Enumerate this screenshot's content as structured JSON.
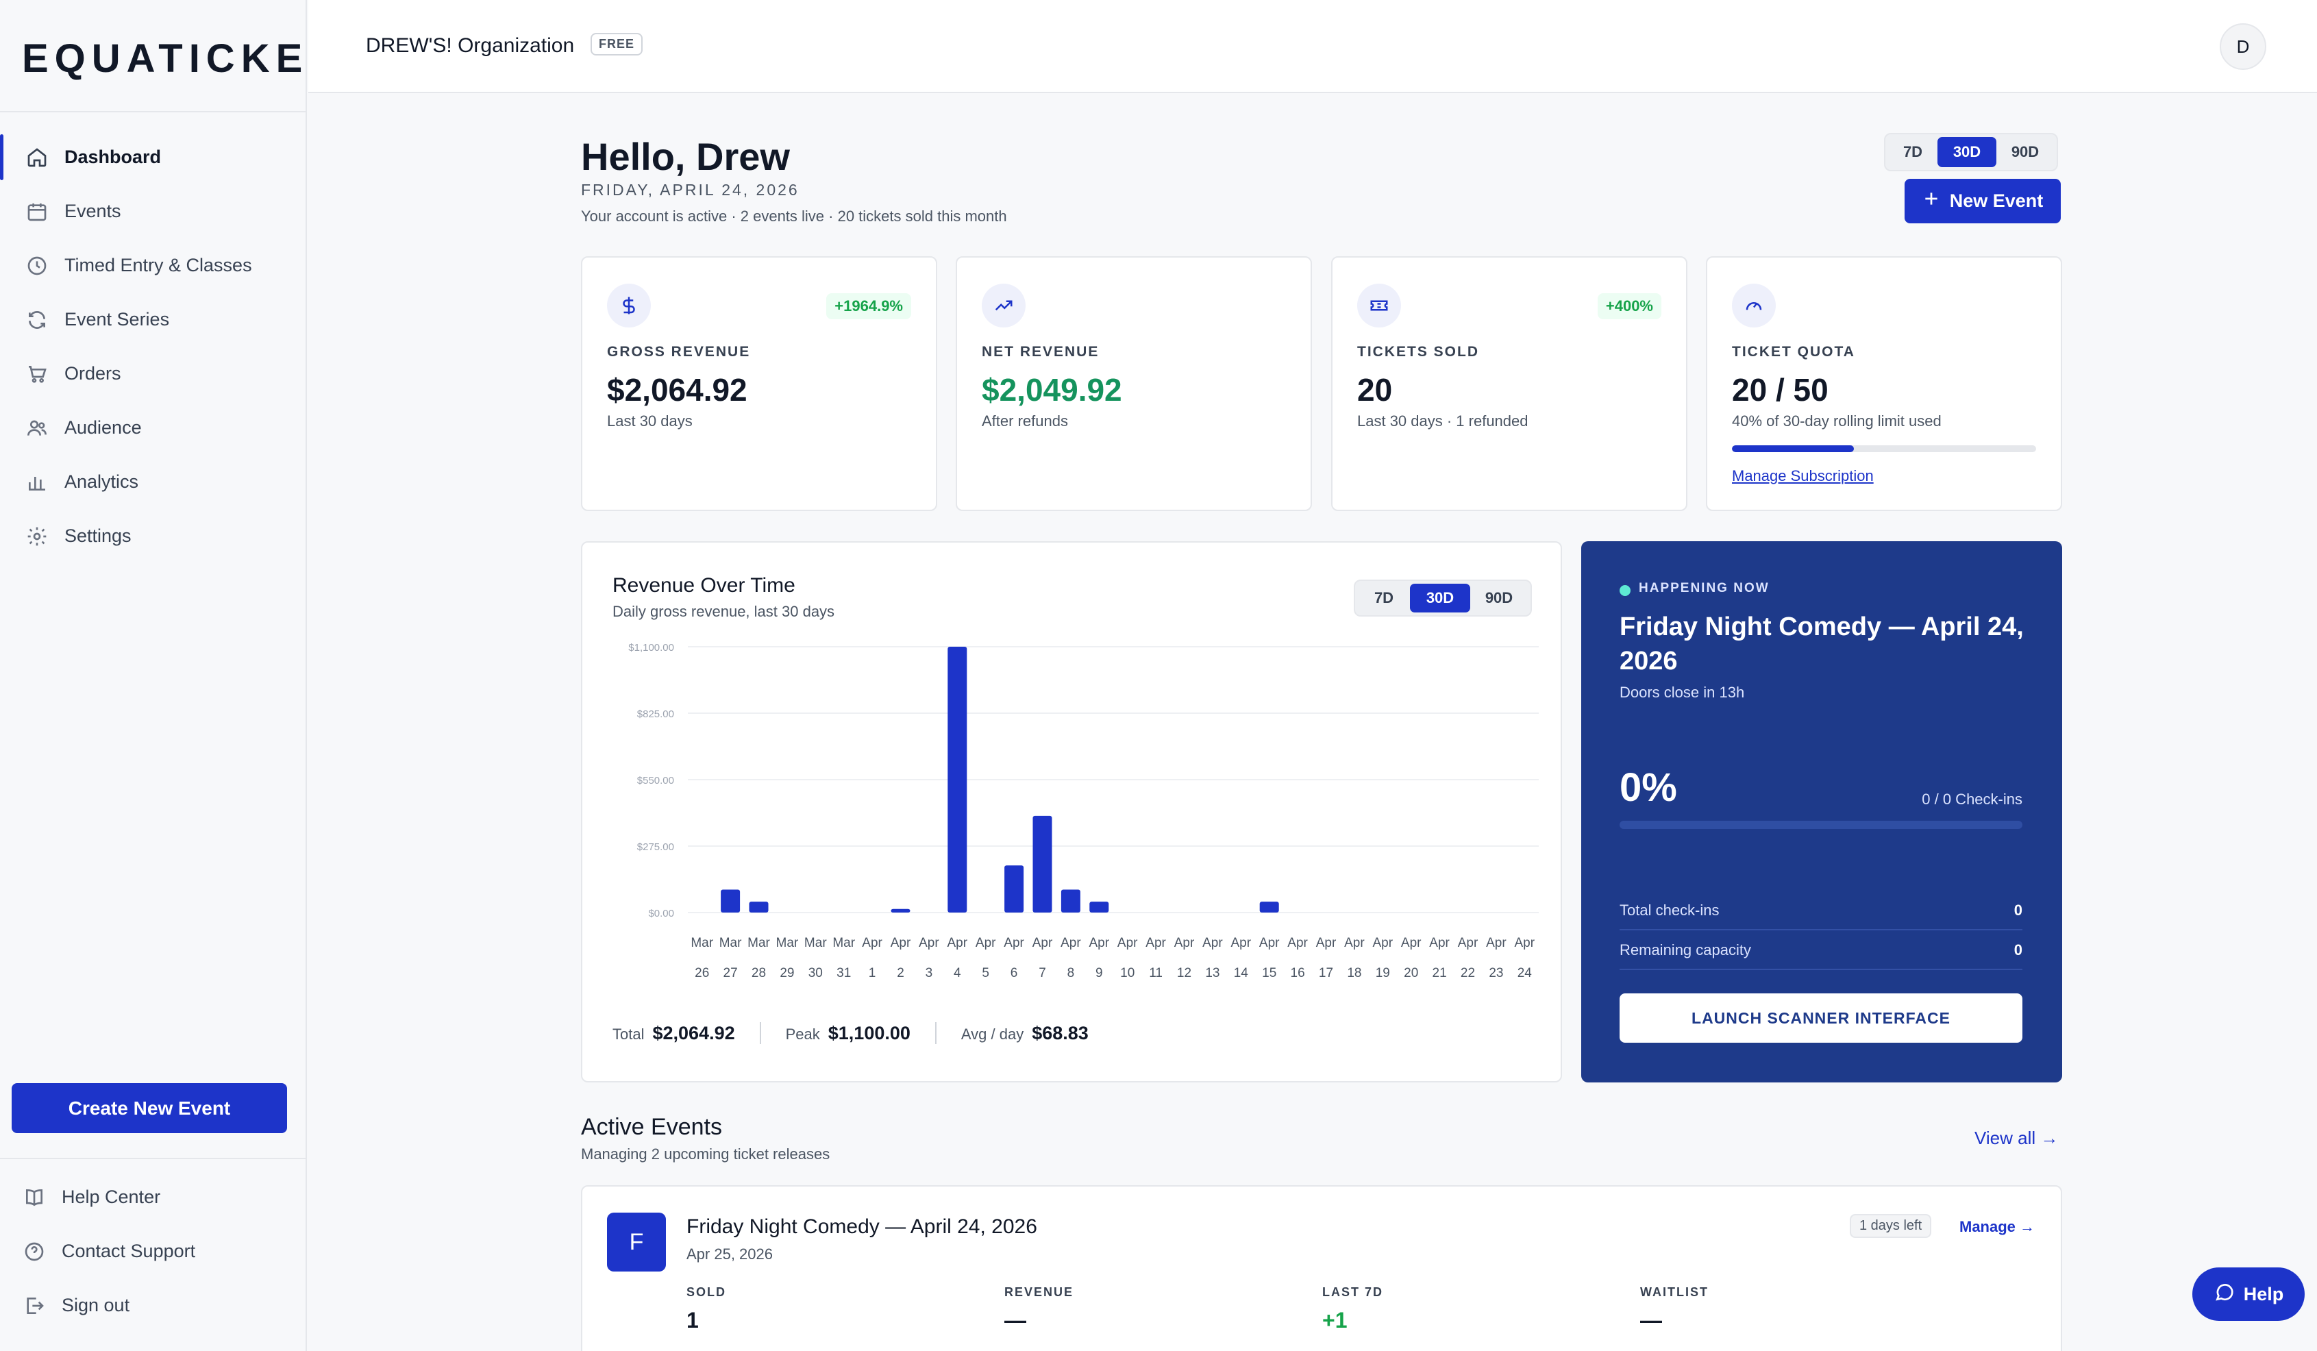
{
  "app": {
    "logo": "EQUATICKET"
  },
  "sidebar": {
    "items": [
      {
        "label": "Dashboard",
        "icon": "home-icon",
        "active": true
      },
      {
        "label": "Events",
        "icon": "calendar-icon"
      },
      {
        "label": "Timed Entry & Classes",
        "icon": "clock-icon"
      },
      {
        "label": "Event Series",
        "icon": "refresh-icon"
      },
      {
        "label": "Orders",
        "icon": "cart-icon"
      },
      {
        "label": "Audience",
        "icon": "users-icon"
      },
      {
        "label": "Analytics",
        "icon": "bar-chart-icon"
      },
      {
        "label": "Settings",
        "icon": "gear-icon"
      }
    ],
    "create_label": "Create New Event",
    "bottom": [
      {
        "label": "Help Center",
        "icon": "book-icon"
      },
      {
        "label": "Contact Support",
        "icon": "help-circle-icon"
      },
      {
        "label": "Sign out",
        "icon": "sign-out-icon"
      }
    ]
  },
  "header": {
    "org": "DREW'S! Organization",
    "plan": "FREE",
    "avatar": "D"
  },
  "greeting": {
    "title": "Hello, Drew",
    "date": "FRIDAY, APRIL 24, 2026",
    "status": "Your account is active · 2 events live · 20 tickets sold this month"
  },
  "range": {
    "options": [
      "7D",
      "30D",
      "90D"
    ],
    "selected": "30D"
  },
  "new_event_label": "New Event",
  "stats": [
    {
      "label": "GROSS REVENUE",
      "value": "$2,064.92",
      "sub": "Last 30 days",
      "delta": "+1964.9%",
      "icon": "dollar-icon"
    },
    {
      "label": "NET REVENUE",
      "value": "$2,049.92",
      "sub": "After refunds",
      "icon": "trend-up-icon"
    },
    {
      "label": "TICKETS SOLD",
      "value": "20",
      "sub": "Last 30 days · 1 refunded",
      "delta": "+400%",
      "icon": "ticket-icon"
    },
    {
      "label": "TICKET QUOTA",
      "value": "20 / 50",
      "sub": "40% of 30-day rolling limit used",
      "icon": "gauge-icon",
      "progress": 0.4,
      "link": "Manage Subscription"
    }
  ],
  "chart_card": {
    "title": "Revenue Over Time",
    "subtitle": "Daily gross revenue, last 30 days",
    "range_options": [
      "7D",
      "30D",
      "90D"
    ],
    "range_selected": "30D",
    "summary": [
      {
        "label": "Total",
        "value": "$2,064.92"
      },
      {
        "label": "Peak",
        "value": "$1,100.00"
      },
      {
        "label": "Avg / day",
        "value": "$68.83"
      }
    ]
  },
  "chart_data": {
    "type": "bar",
    "title": "Revenue Over Time",
    "subtitle": "Daily gross revenue, last 30 days",
    "categories": [
      [
        "Mar",
        "26"
      ],
      [
        "Mar",
        "27"
      ],
      [
        "Mar",
        "28"
      ],
      [
        "Mar",
        "29"
      ],
      [
        "Mar",
        "30"
      ],
      [
        "Mar",
        "31"
      ],
      [
        "Apr",
        "1"
      ],
      [
        "Apr",
        "2"
      ],
      [
        "Apr",
        "3"
      ],
      [
        "Apr",
        "4"
      ],
      [
        "Apr",
        "5"
      ],
      [
        "Apr",
        "6"
      ],
      [
        "Apr",
        "7"
      ],
      [
        "Apr",
        "8"
      ],
      [
        "Apr",
        "9"
      ],
      [
        "Apr",
        "10"
      ],
      [
        "Apr",
        "11"
      ],
      [
        "Apr",
        "12"
      ],
      [
        "Apr",
        "13"
      ],
      [
        "Apr",
        "14"
      ],
      [
        "Apr",
        "15"
      ],
      [
        "Apr",
        "16"
      ],
      [
        "Apr",
        "17"
      ],
      [
        "Apr",
        "18"
      ],
      [
        "Apr",
        "19"
      ],
      [
        "Apr",
        "20"
      ],
      [
        "Apr",
        "21"
      ],
      [
        "Apr",
        "22"
      ],
      [
        "Apr",
        "23"
      ],
      [
        "Apr",
        "24"
      ]
    ],
    "values": [
      0,
      95,
      45,
      0,
      0,
      0,
      0,
      15,
      0,
      1100,
      0,
      195,
      400,
      95,
      45,
      0,
      0,
      0,
      0,
      0,
      45,
      0,
      0,
      0,
      0,
      0,
      0,
      0,
      0,
      0
    ],
    "yticks": [
      "$0.00",
      "$275.00",
      "$550.00",
      "$825.00",
      "$1,100.00"
    ],
    "ylim": [
      0,
      1100
    ],
    "grid": true,
    "color": "#1d34c9"
  },
  "happening": {
    "tag": "HAPPENING NOW",
    "title": "Friday Night Comedy — April 24, 2026",
    "sub": "Doors close in 13h",
    "percent": "0%",
    "checkins": "0 / 0 Check-ins",
    "rows": [
      {
        "label": "Total check-ins",
        "value": "0"
      },
      {
        "label": "Remaining capacity",
        "value": "0"
      }
    ],
    "launch_label": "LAUNCH SCANNER INTERFACE"
  },
  "active_events": {
    "title": "Active Events",
    "subtitle": "Managing 2 upcoming ticket releases",
    "view_all": "View all →",
    "items": [
      {
        "initial": "F",
        "name": "Friday Night Comedy — April 24, 2026",
        "date": "Apr 25, 2026",
        "badge": "1 days left",
        "manage": "Manage →",
        "metrics": [
          {
            "label": "SOLD",
            "value": "1"
          },
          {
            "label": "REVENUE",
            "value": "—"
          },
          {
            "label": "LAST 7D",
            "value": "+1"
          },
          {
            "label": "WAITLIST",
            "value": "—"
          }
        ]
      }
    ]
  },
  "help_label": "Help"
}
